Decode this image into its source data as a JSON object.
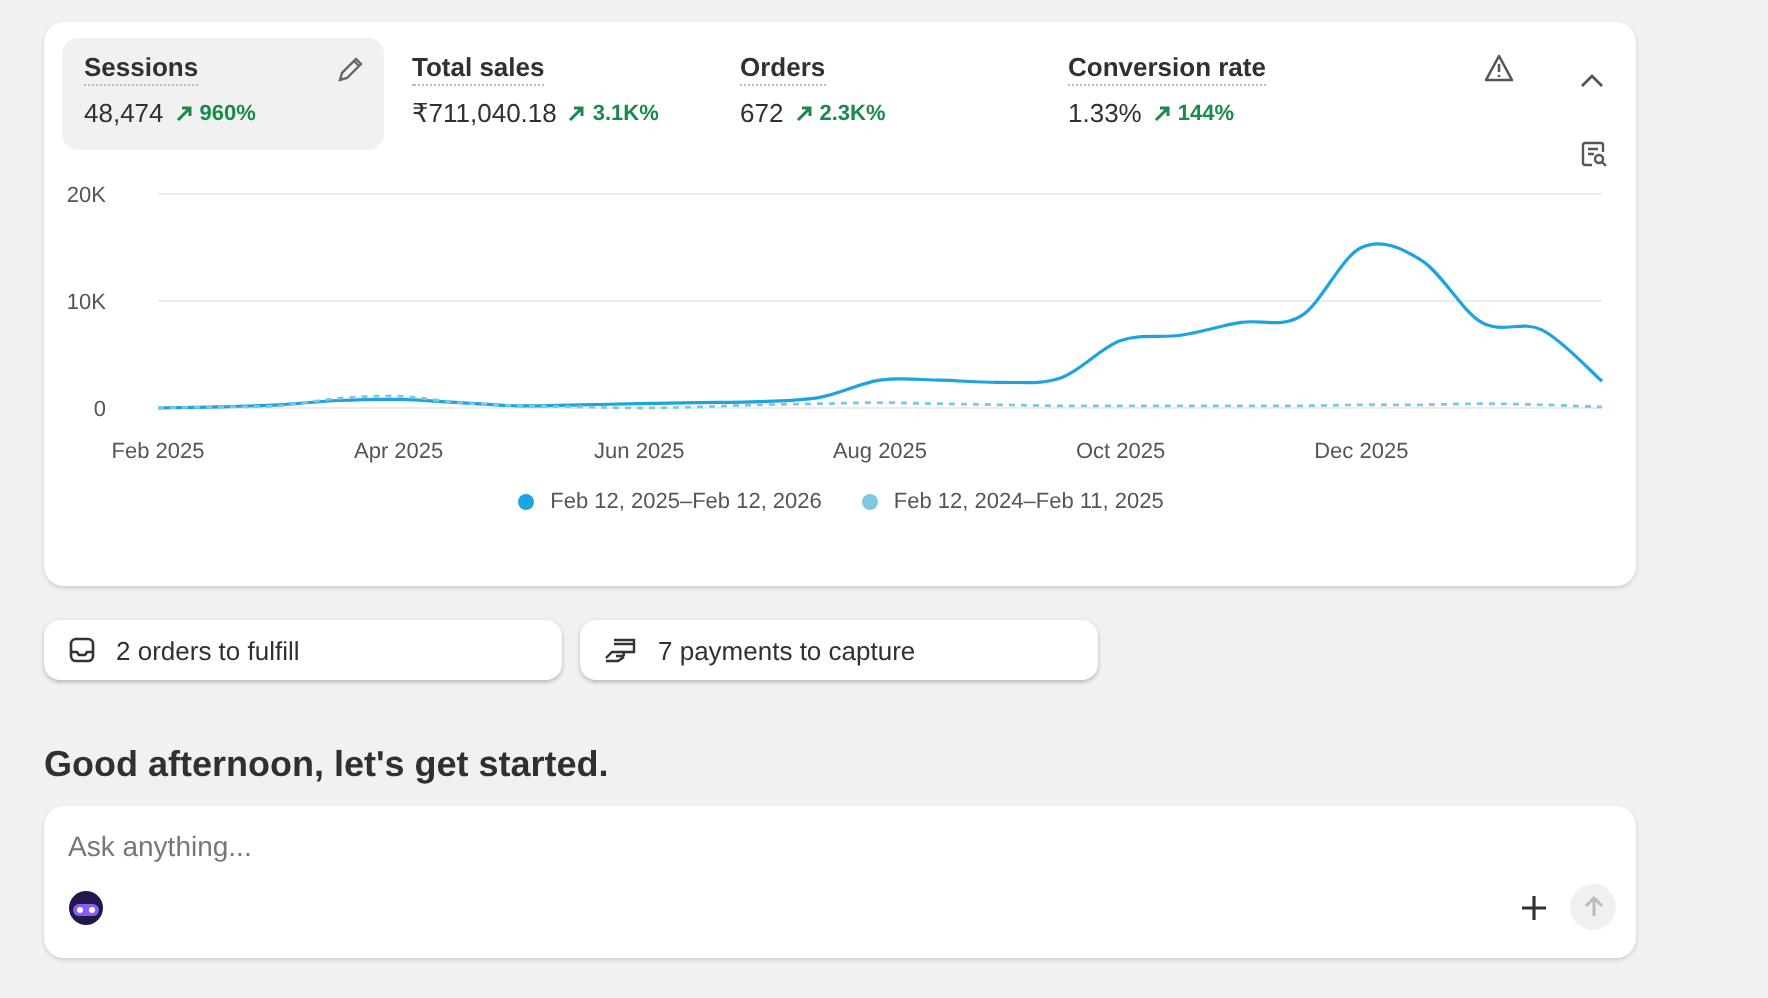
{
  "metrics": [
    {
      "label": "Sessions",
      "value": "48,474",
      "change": "960%",
      "selected": true
    },
    {
      "label": "Total sales",
      "value": "₹711,040.18",
      "change": "3.1K%",
      "selected": false
    },
    {
      "label": "Orders",
      "value": "672",
      "change": "2.3K%",
      "selected": false
    },
    {
      "label": "Conversion rate",
      "value": "1.33%",
      "change": "144%",
      "selected": false
    }
  ],
  "chart_data": {
    "type": "line",
    "categories": [
      "Feb 2025",
      null,
      null,
      null,
      "Apr 2025",
      null,
      null,
      null,
      "Jun 2025",
      null,
      null,
      null,
      "Aug 2025",
      null,
      null,
      null,
      "Oct 2025",
      null,
      null,
      null,
      "Dec 2025",
      null,
      null,
      null,
      null
    ],
    "yticks": [
      {
        "value": 0,
        "label": "0"
      },
      {
        "value": 10000,
        "label": "10K"
      },
      {
        "value": 20000,
        "label": "20K"
      }
    ],
    "ylim": [
      0,
      20000
    ],
    "legend": "bottom",
    "series": [
      {
        "name": "Feb 12, 2025–Feb 12, 2026",
        "color": "#1ba4e0",
        "line_style": "solid",
        "values": [
          0,
          100,
          300,
          700,
          800,
          500,
          200,
          300,
          400,
          500,
          600,
          1000,
          2600,
          2600,
          2400,
          2800,
          6300,
          6800,
          8000,
          8600,
          15000,
          13800,
          8000,
          7300,
          2500
        ]
      },
      {
        "name": "Feb 12, 2024–Feb 11, 2025",
        "color": "#7ec8e3",
        "line_style": "dotted",
        "values": [
          0,
          100,
          200,
          900,
          1100,
          500,
          200,
          100,
          0,
          100,
          300,
          400,
          500,
          400,
          300,
          200,
          200,
          200,
          200,
          200,
          300,
          300,
          400,
          300,
          100
        ]
      }
    ]
  },
  "tasks": [
    {
      "kind": "inbox",
      "label": "2 orders to fulfill"
    },
    {
      "kind": "payment",
      "label": "7 payments to capture"
    }
  ],
  "greeting": "Good afternoon, let's get started.",
  "prompt": {
    "placeholder": "Ask anything..."
  }
}
